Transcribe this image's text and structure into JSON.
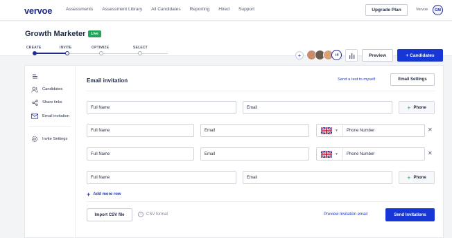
{
  "nav": {
    "logo": "vervoe",
    "links": [
      "Assessments",
      "Assessment Library",
      "All Candidates",
      "Reporting",
      "Hired",
      "Support"
    ],
    "upgrade": "Upgrade Plan",
    "account_name": "Vervoe",
    "avatar_initials": "GM"
  },
  "header": {
    "title": "Growth Marketer",
    "status": "Live",
    "steps": [
      "CREATE",
      "INVITE",
      "OPTIMIZE",
      "SELECT"
    ],
    "more_count": "+4",
    "preview": "Preview",
    "candidates": "+ Candidates"
  },
  "sidebar": {
    "items": [
      {
        "label": "",
        "icon": "list-icon"
      },
      {
        "label": "Candidates",
        "icon": "people-icon"
      },
      {
        "label": "Share links",
        "icon": "share-icon"
      },
      {
        "label": "Email invitation",
        "icon": "mail-icon"
      },
      {
        "label": "Invite Settings",
        "icon": "gear-icon"
      }
    ]
  },
  "main": {
    "title": "Email invitation",
    "send_test": "Send a test to myself",
    "email_settings": "Email Settings",
    "rows": [
      {
        "name": "Full Name",
        "email": "Email",
        "phone": null
      },
      {
        "name": "Full Name",
        "email": "Email",
        "phone": "Phone Number"
      },
      {
        "name": "Full Name",
        "email": "Email",
        "phone": "Phone Number"
      },
      {
        "name": "Full Name",
        "email": "Email",
        "phone": null
      }
    ],
    "phone_button": "Phone",
    "add_row": "Add more row",
    "import_csv": "Import CSV file",
    "csv_format": "CSV format",
    "preview_invitation": "Preview Invitation email",
    "send_invitations": "Send Invitations"
  },
  "colors": {
    "primary": "#1736d6",
    "brand": "#1e2b8f",
    "live": "#21a35a"
  }
}
